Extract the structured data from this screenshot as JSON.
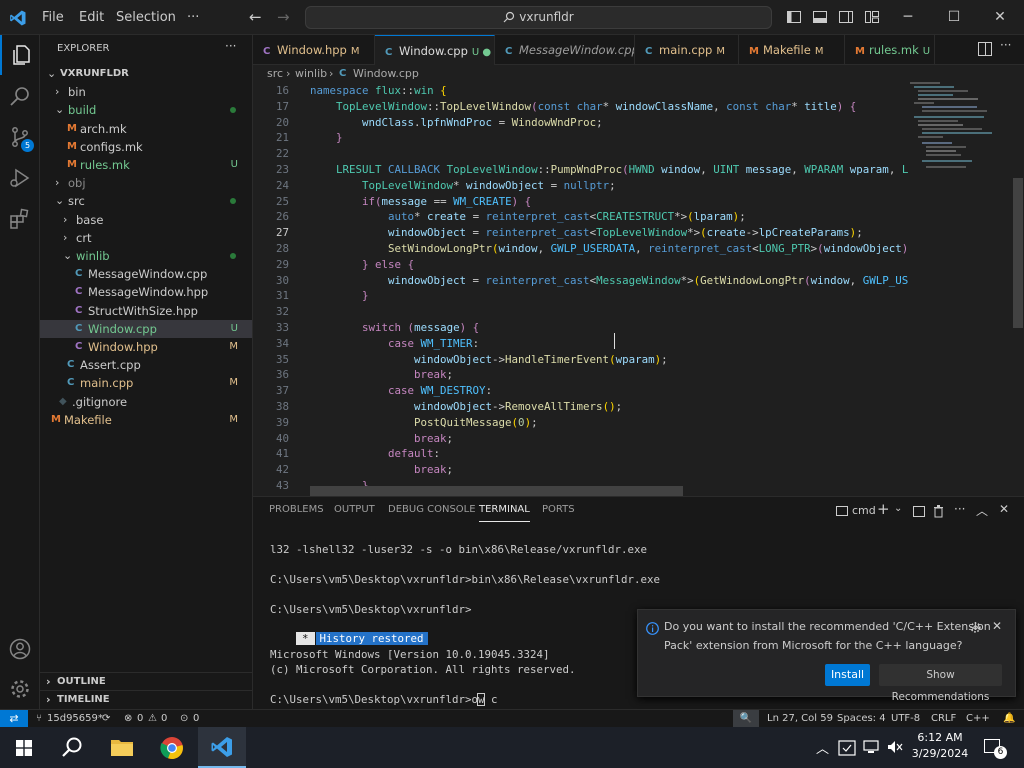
{
  "title_bar": {
    "menu": [
      "File",
      "Edit",
      "Selection",
      "···"
    ],
    "search_text": "vxrunfldr",
    "nav_back": "←",
    "nav_forward": "→",
    "minimize": "─",
    "maximize": "☐",
    "close": "✕"
  },
  "activity_bar": {
    "scm_badge": "5"
  },
  "explorer": {
    "header": "EXPLORER",
    "more": "···",
    "items": [
      {
        "label": "VXRUNFLDR",
        "indent": 0,
        "chevron": "⌄",
        "bold": true
      },
      {
        "label": "bin",
        "indent": 1,
        "chevron": "›"
      },
      {
        "label": "build",
        "indent": 1,
        "chevron": "⌄",
        "color": "#73c991",
        "dot": true
      },
      {
        "label": "arch.mk",
        "indent": 2,
        "icon": "M",
        "iconColor": "#e37933"
      },
      {
        "label": "configs.mk",
        "indent": 2,
        "icon": "M",
        "iconColor": "#e37933"
      },
      {
        "label": "rules.mk",
        "indent": 2,
        "icon": "M",
        "iconColor": "#e37933",
        "color": "#73c991",
        "status": "U"
      },
      {
        "label": "obj",
        "indent": 1,
        "chevron": "›",
        "color": "#8c8c8c"
      },
      {
        "label": "src",
        "indent": 1,
        "chevron": "⌄",
        "dot": true
      },
      {
        "label": "base",
        "indent": 2,
        "chevron": "›"
      },
      {
        "label": "crt",
        "indent": 2,
        "chevron": "›"
      },
      {
        "label": "winlib",
        "indent": 2,
        "chevron": "⌄",
        "color": "#73c991",
        "dot": true
      },
      {
        "label": "MessageWindow.cpp",
        "indent": 3,
        "icon": "C",
        "iconColor": "#519aba"
      },
      {
        "label": "MessageWindow.hpp",
        "indent": 3,
        "icon": "C",
        "iconColor": "#a074c4"
      },
      {
        "label": "StructWithSize.hpp",
        "indent": 3,
        "icon": "C",
        "iconColor": "#a074c4"
      },
      {
        "label": "Window.cpp",
        "indent": 3,
        "icon": "C",
        "iconColor": "#519aba",
        "color": "#73c991",
        "status": "U",
        "selected": true
      },
      {
        "label": "Window.hpp",
        "indent": 3,
        "icon": "C",
        "iconColor": "#a074c4",
        "color": "#e2c08d",
        "status": "M"
      },
      {
        "label": "Assert.cpp",
        "indent": 2,
        "icon": "C",
        "iconColor": "#519aba"
      },
      {
        "label": "main.cpp",
        "indent": 2,
        "icon": "C",
        "iconColor": "#519aba",
        "color": "#e2c08d",
        "status": "M"
      },
      {
        "label": ".gitignore",
        "indent": 1,
        "icon": "◆",
        "iconColor": "#41535b"
      },
      {
        "label": "Makefile",
        "indent": 0,
        "icon": "M",
        "iconColor": "#e37933",
        "color": "#e2c08d",
        "status": "M"
      }
    ],
    "outline": "OUTLINE",
    "timeline": "TIMELINE"
  },
  "tabs": [
    {
      "label": "Window.hpp",
      "icon": "C",
      "iconColor": "#a074c4",
      "status": "M",
      "color": "#e2c08d"
    },
    {
      "label": "Window.cpp",
      "icon": "C",
      "iconColor": "#519aba",
      "status": "U ●",
      "color": "#73c991",
      "active": true
    },
    {
      "label": "MessageWindow.cpp",
      "icon": "C",
      "iconColor": "#519aba",
      "status": "",
      "italic": true
    },
    {
      "label": "main.cpp",
      "icon": "C",
      "iconColor": "#519aba",
      "status": "M",
      "color": "#e2c08d"
    },
    {
      "label": "Makefile",
      "icon": "M",
      "iconColor": "#e37933",
      "status": "M",
      "color": "#e2c08d"
    },
    {
      "label": "rules.mk",
      "icon": "M",
      "iconColor": "#e37933",
      "status": "U",
      "color": "#73c991"
    }
  ],
  "breadcrumb": [
    "src",
    "winlib",
    "Window.cpp"
  ],
  "code_lines": [
    {
      "n": "16",
      "html": "<span class='k'>namespace</span> <span class='t'>flux</span>::<span class='t'>win</span> <span class='p'>{</span>"
    },
    {
      "n": "17",
      "html": "    <span class='t'>TopLevelWindow</span>::<span class='f'>TopLevelWindow</span><span class='c'>(</span><span class='k'>const</span> <span class='k'>char</span>* <span class='v'>windowClassName</span>, <span class='k'>const</span> <span class='k'>char</span>* <span class='v'>title</span><span class='c'>)</span> <span class='c'>{</span>"
    },
    {
      "n": "20",
      "html": "        <span class='v'>wndClass</span>.<span class='v'>lpfnWndProc</span> = <span class='f'>WindowWndProc</span>;"
    },
    {
      "n": "21",
      "html": "    <span class='c'>}</span>"
    },
    {
      "n": "22",
      "html": ""
    },
    {
      "n": "23",
      "html": "    <span class='t'>LRESULT</span> <span class='k'>CALLBACK</span> <span class='t'>TopLevelWindow</span>::<span class='f'>PumpWndProc</span><span class='c'>(</span><span class='t'>HWND</span> <span class='v'>window</span>, <span class='t'>UINT</span> <span class='v'>message</span>, <span class='t'>WPARAM</span> <span class='v'>wparam</span>, <span class='t'>LPA</span>"
    },
    {
      "n": "24",
      "html": "        <span class='t'>TopLevelWindow</span>* <span class='v'>windowObject</span> = <span class='k'>nullptr</span>;"
    },
    {
      "n": "25",
      "html": "        <span class='c'>if</span><span class='c'>(</span><span class='v'>message</span> == <span class='m'>WM_CREATE</span><span class='c'>)</span> <span class='c'>{</span>"
    },
    {
      "n": "26",
      "html": "            <span class='k'>auto</span>* <span class='v'>create</span> = <span class='k'>reinterpret_cast</span>&lt;<span class='t'>CREATESTRUCT</span>*&gt;<span class='p'>(</span><span class='v'>lparam</span><span class='p'>)</span>;"
    },
    {
      "n": "27",
      "html": "            <span class='v'>windowObject</span> = <span class='k'>reinterpret_cast</span>&lt;<span class='t'>TopLevelWindow</span>*&gt;<span class='p'>(</span><span class='v'>create</span>-&gt;<span class='v'>lpCreateParams</span><span class='p'>)</span>;",
      "current": true
    },
    {
      "n": "28",
      "html": "            <span class='f'>SetWindowLongPtr</span><span class='p'>(</span><span class='v'>window</span>, <span class='m'>GWLP_USERDATA</span>, <span class='k'>reinterpret_cast</span>&lt;<span class='t'>LONG_PTR</span>&gt;<span class='c'>(</span><span class='v'>windowObject</span><span class='c'>)</span><span class='p'>)</span>;"
    },
    {
      "n": "29",
      "html": "        <span class='c'>}</span> <span class='c'>else</span> <span class='c'>{</span>"
    },
    {
      "n": "30",
      "html": "            <span class='v'>windowObject</span> = <span class='k'>reinterpret_cast</span>&lt;<span class='t'>MessageWindow</span>*&gt;<span class='p'>(</span><span class='f'>GetWindowLongPtr</span><span class='c'>(</span><span class='v'>window</span>, <span class='m'>GWLP_USER</span>"
    },
    {
      "n": "31",
      "html": "        <span class='c'>}</span>"
    },
    {
      "n": "32",
      "html": ""
    },
    {
      "n": "33",
      "html": "        <span class='c'>switch</span> <span class='c'>(</span><span class='v'>message</span><span class='c'>)</span> <span class='c'>{</span>"
    },
    {
      "n": "34",
      "html": "            <span class='c'>case</span> <span class='m'>WM_TIMER</span>:"
    },
    {
      "n": "35",
      "html": "                <span class='v'>windowObject</span>-&gt;<span class='f'>HandleTimerEvent</span><span class='p'>(</span><span class='v'>wparam</span><span class='p'>)</span>;"
    },
    {
      "n": "36",
      "html": "                <span class='c'>break</span>;"
    },
    {
      "n": "37",
      "html": "            <span class='c'>case</span> <span class='m'>WM_DESTROY</span>:"
    },
    {
      "n": "38",
      "html": "                <span class='v'>windowObject</span>-&gt;<span class='f'>RemoveAllTimers</span><span class='p'>()</span>;"
    },
    {
      "n": "39",
      "html": "                <span class='f'>PostQuitMessage</span><span class='p'>(</span><span class='n'>0</span><span class='p'>)</span>;"
    },
    {
      "n": "40",
      "html": "                <span class='c'>break</span>;"
    },
    {
      "n": "41",
      "html": "            <span class='c'>default</span>:"
    },
    {
      "n": "42",
      "html": "                <span class='c'>break</span>;"
    },
    {
      "n": "43",
      "html": "        <span class='c'>}</span>"
    }
  ],
  "panel": {
    "tabs": [
      "PROBLEMS",
      "OUTPUT",
      "DEBUG CONSOLE",
      "TERMINAL",
      "PORTS"
    ],
    "active_tab": "TERMINAL",
    "terminal_name": "cmd"
  },
  "terminal": [
    "l32 -lshell32 -luser32 -s -o bin\\x86\\Release/vxrunfldr.exe",
    "",
    "C:\\Users\\vm5\\Desktop\\vxrunfldr>bin\\x86\\Release\\vxrunfldr.exe",
    "",
    "C:\\Users\\vm5\\Desktop\\vxrunfldr>",
    "",
    "",
    "Microsoft Windows [Version 10.0.19045.3324]",
    "(c) Microsoft Corporation. All rights reserved.",
    "",
    "C:\\Users\\vm5\\Desktop\\vxrunfldr>ow c"
  ],
  "history_marker": "*",
  "history_restored": "History restored",
  "notification": {
    "message_line1": "Do you want to install the recommended 'C/C++ Extension",
    "message_line2": "Pack' extension from Microsoft for the C++ language?",
    "install": "Install",
    "show_recommendations": "Show Recommendations"
  },
  "status_bar": {
    "remote": "⇄",
    "branch": "15d95659*",
    "sync": "⟳",
    "errors": "0",
    "warnings": "0",
    "ports": "0",
    "position": "Ln 27, Col 59",
    "spaces": "Spaces: 4",
    "encoding": "UTF-8",
    "eol": "CRLF",
    "language": "C++"
  },
  "taskbar": {
    "time": "6:12 AM",
    "date": "3/29/2024",
    "notif_count": "6"
  },
  "colors": {
    "accent": "#0078d4",
    "git_added": "#73c991",
    "git_modified": "#e2c08d"
  }
}
